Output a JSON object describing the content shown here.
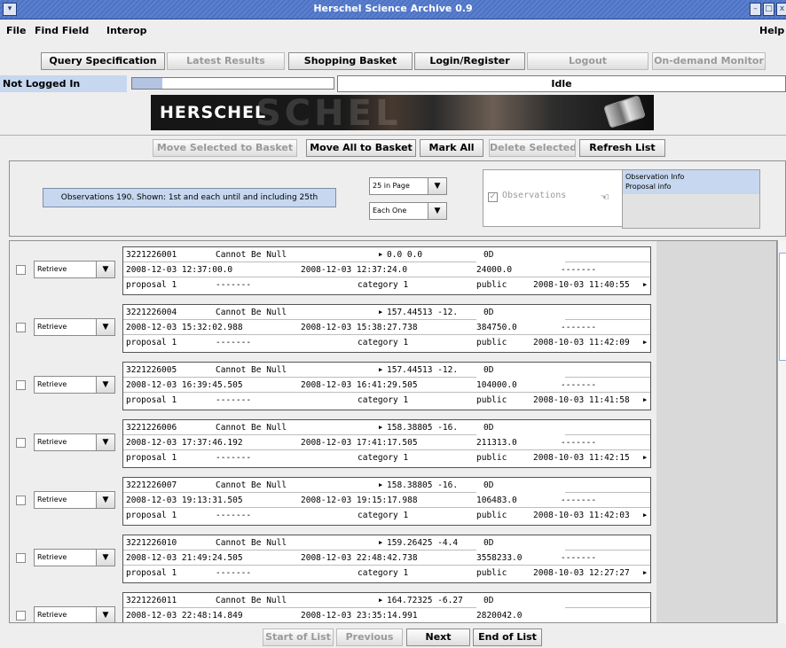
{
  "window": {
    "title": "Herschel Science Archive 0.9"
  },
  "menu": {
    "file": "File",
    "find_field": "Find Field",
    "interop": "Interop",
    "help": "Help"
  },
  "nav_tabs": {
    "query_spec": "Query Specification",
    "latest_results": "Latest Results",
    "shopping_basket": "Shopping Basket",
    "login_register": "Login/Register",
    "logout": "Logout",
    "on_demand_monitor": "On-demand Monitor"
  },
  "status": {
    "login": "Not Logged In",
    "state": "Idle",
    "progress_percent": 15
  },
  "banner": {
    "logo": "HERSCHEL",
    "ghost": "SCHEL"
  },
  "actions": {
    "move_selected": "Move Selected to Basket",
    "move_all": "Move All to Basket",
    "mark_all": "Mark All",
    "delete_selected": "Delete Selected",
    "refresh_list": "Refresh List"
  },
  "panel": {
    "summary": "Observations 190. Shown: 1st and each until and including 25th",
    "page_size": "25 in Page",
    "step": "Each One",
    "checkbox_label": "Observations",
    "info_items": [
      "Observation Info",
      "Proposal info"
    ]
  },
  "rows": [
    {
      "id": "3221226001",
      "name": "Cannot Be Null",
      "coords": "0.0 0.0",
      "od": "0D",
      "start": "2008-12-03 12:37:00.0",
      "end": "2008-12-03 12:37:24.0",
      "duration": "24000.0",
      "dashes": "-------",
      "proposal": "proposal 1",
      "pdash": "-------",
      "category": "category 1",
      "status": "public",
      "date": "2008-10-03 11:40:55",
      "action": "Retrieve"
    },
    {
      "id": "3221226004",
      "name": "Cannot Be Null",
      "coords": "157.44513 -12.",
      "od": "0D",
      "start": "2008-12-03 15:32:02.988",
      "end": "2008-12-03 15:38:27.738",
      "duration": "384750.0",
      "dashes": "-------",
      "proposal": "proposal 1",
      "pdash": "-------",
      "category": "category 1",
      "status": "public",
      "date": "2008-10-03 11:42:09",
      "action": "Retrieve"
    },
    {
      "id": "3221226005",
      "name": "Cannot Be Null",
      "coords": "157.44513 -12.",
      "od": "0D",
      "start": "2008-12-03 16:39:45.505",
      "end": "2008-12-03 16:41:29.505",
      "duration": "104000.0",
      "dashes": "-------",
      "proposal": "proposal 1",
      "pdash": "-------",
      "category": "category 1",
      "status": "public",
      "date": "2008-10-03 11:41:58",
      "action": "Retrieve"
    },
    {
      "id": "3221226006",
      "name": "Cannot Be Null",
      "coords": "158.38805 -16.",
      "od": "0D",
      "start": "2008-12-03 17:37:46.192",
      "end": "2008-12-03 17:41:17.505",
      "duration": "211313.0",
      "dashes": "-------",
      "proposal": "proposal 1",
      "pdash": "-------",
      "category": "category 1",
      "status": "public",
      "date": "2008-10-03 11:42:15",
      "action": "Retrieve"
    },
    {
      "id": "3221226007",
      "name": "Cannot Be Null",
      "coords": "158.38805 -16.",
      "od": "0D",
      "start": "2008-12-03 19:13:31.505",
      "end": "2008-12-03 19:15:17.988",
      "duration": "106483.0",
      "dashes": "-------",
      "proposal": "proposal 1",
      "pdash": "-------",
      "category": "category 1",
      "status": "public",
      "date": "2008-10-03 11:42:03",
      "action": "Retrieve"
    },
    {
      "id": "3221226010",
      "name": "Cannot Be Null",
      "coords": "159.26425 -4.4",
      "od": "0D",
      "start": "2008-12-03 21:49:24.505",
      "end": "2008-12-03 22:48:42.738",
      "duration": "3558233.0",
      "dashes": "-------",
      "proposal": "proposal 1",
      "pdash": "-------",
      "category": "category 1",
      "status": "public",
      "date": "2008-10-03 12:27:27",
      "action": "Retrieve"
    },
    {
      "id": "3221226011",
      "name": "Cannot Be Null",
      "coords": "164.72325 -6.27",
      "od": "0D",
      "start": "2008-12-03 22:48:14.849",
      "end": "2008-12-03 23:35:14.991",
      "duration": "2820042.0",
      "dashes": "",
      "proposal": "",
      "pdash": "",
      "category": "",
      "status": "",
      "date": "",
      "action": "Retrieve"
    }
  ],
  "pager": {
    "start": "Start of List",
    "previous": "Previous",
    "next": "Next",
    "end": "End of List"
  }
}
